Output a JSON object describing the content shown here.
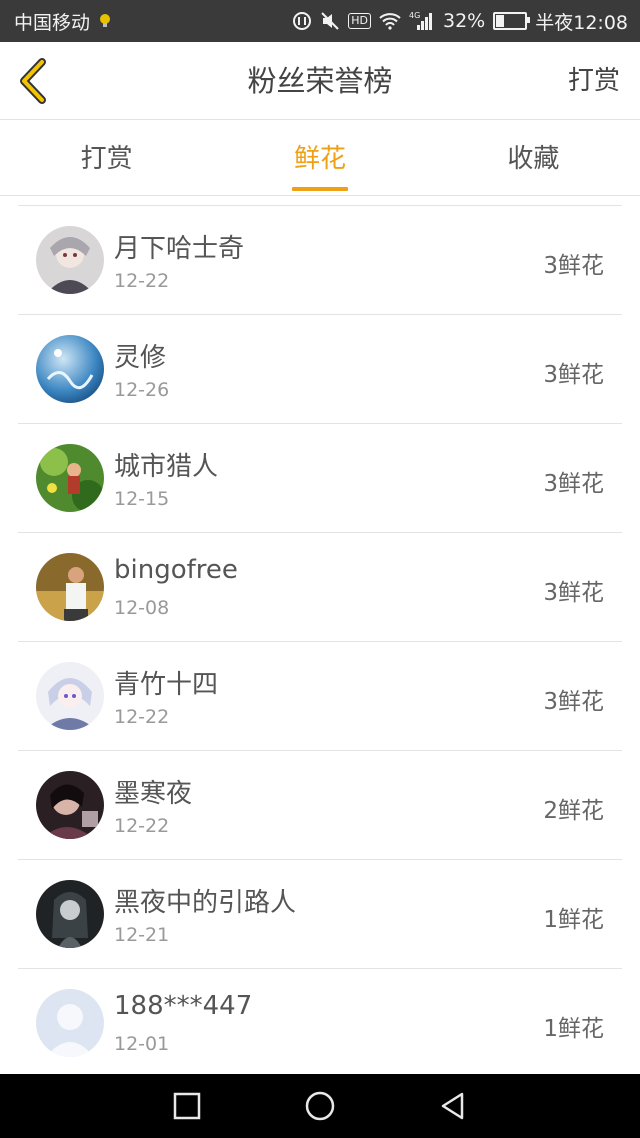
{
  "status_bar": {
    "carrier": "中国移动",
    "battery_percent": "32%",
    "battery_level": 0.32,
    "network": "4G",
    "time": "半夜12:08",
    "icons": [
      "location-icon",
      "nfc-icon",
      "mute-icon",
      "hd-icon",
      "wifi-icon",
      "signal-icon",
      "battery-icon"
    ]
  },
  "header": {
    "title": "粉丝荣誉榜",
    "action_label": "打赏",
    "back_icon": "chevron-left-icon",
    "accent_color": "#f0a015"
  },
  "tabs": [
    {
      "label": "打赏",
      "active": false
    },
    {
      "label": "鲜花",
      "active": true
    },
    {
      "label": "收藏",
      "active": false
    }
  ],
  "fans": [
    {
      "name": "月下哈士奇",
      "date": "12-22",
      "count": "3鲜花"
    },
    {
      "name": "灵修",
      "date": "12-26",
      "count": "3鲜花"
    },
    {
      "name": "城市猎人",
      "date": "12-15",
      "count": "3鲜花"
    },
    {
      "name": "bingofree",
      "date": "12-08",
      "count": "3鲜花"
    },
    {
      "name": "青竹十四",
      "date": "12-22",
      "count": "3鲜花"
    },
    {
      "name": "墨寒夜",
      "date": "12-22",
      "count": "2鲜花"
    },
    {
      "name": "黑夜中的引路人",
      "date": "12-21",
      "count": "1鲜花"
    },
    {
      "name": "188***447",
      "date": "12-01",
      "count": "1鲜花"
    }
  ],
  "nav_bar": {
    "buttons": [
      "recents-square-icon",
      "home-circle-icon",
      "back-triangle-icon"
    ]
  }
}
